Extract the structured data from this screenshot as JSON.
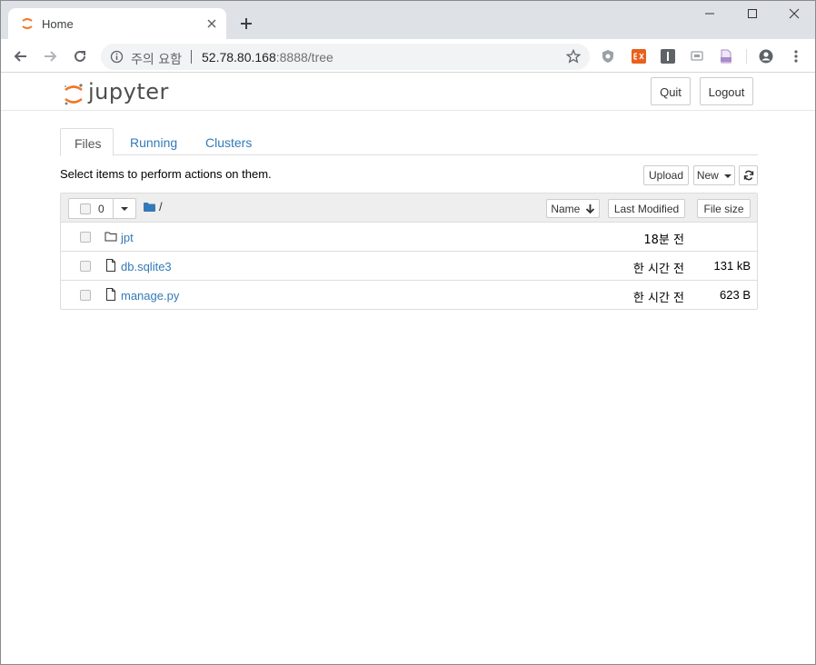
{
  "browser": {
    "tab_title": "Home",
    "security_label": "주의 요함",
    "url_host": "52.78.80.168",
    "url_path": ":8888/tree"
  },
  "header": {
    "logo_text": "jupyter",
    "quit_label": "Quit",
    "logout_label": "Logout"
  },
  "tabs": [
    {
      "label": "Files",
      "active": true
    },
    {
      "label": "Running",
      "active": false
    },
    {
      "label": "Clusters",
      "active": false
    }
  ],
  "toolbar": {
    "hint": "Select items to perform actions on them.",
    "upload_label": "Upload",
    "new_label": "New"
  },
  "filelist": {
    "selected_count": "0",
    "breadcrumb": "/",
    "col_name": "Name",
    "col_modified": "Last Modified",
    "col_size": "File size",
    "rows": [
      {
        "type": "folder",
        "name": "jpt",
        "modified": "18분 전",
        "size": ""
      },
      {
        "type": "file",
        "name": "db.sqlite3",
        "modified": "한 시간 전",
        "size": "131 kB"
      },
      {
        "type": "file",
        "name": "manage.py",
        "modified": "한 시간 전",
        "size": "623 B"
      }
    ]
  },
  "colors": {
    "link": "#337ab7",
    "jupyter_orange": "#f37726",
    "chrome_tabstrip": "#dee1e6"
  }
}
